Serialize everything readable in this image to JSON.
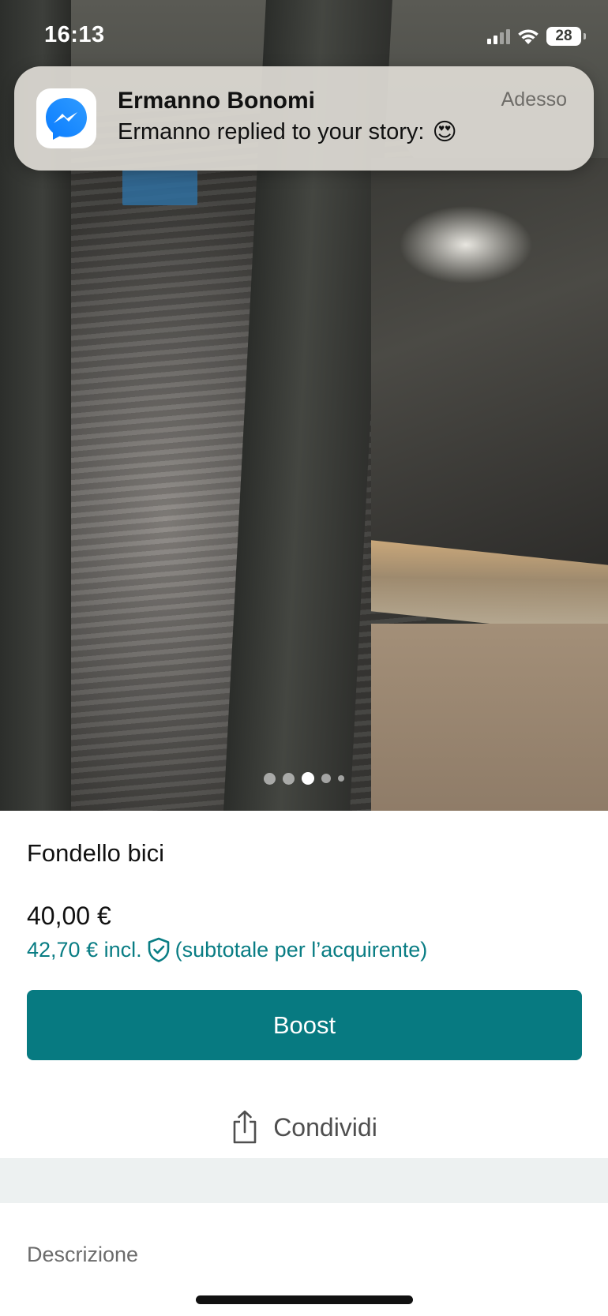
{
  "status_bar": {
    "time": "16:13",
    "battery": "28",
    "icons": [
      "cellular-signal-icon",
      "wifi-icon",
      "battery-icon"
    ]
  },
  "notification": {
    "app_icon": "messenger-icon",
    "sender": "Ermanno Bonomi",
    "time": "Adesso",
    "message": "Ermanno replied to your story:",
    "emoji": "😍"
  },
  "photo": {
    "page_count": 5,
    "current_page": 3
  },
  "listing": {
    "title": "Fondello bici",
    "price": "40,00 €",
    "price_incl_amount": "42,70 € incl.",
    "price_incl_note": "(subtotale per l’acquirente)",
    "boost_label": "Boost",
    "share_label": "Condividi",
    "description_label": "Descrizione"
  },
  "colors": {
    "accent": "#077a81",
    "accent_text": "#097d84",
    "band": "#edf1f1"
  }
}
